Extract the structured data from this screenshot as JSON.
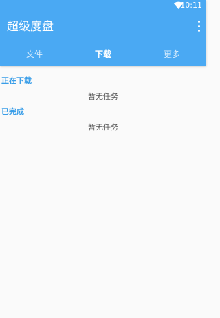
{
  "status_bar": {
    "time": "10:11"
  },
  "app_bar": {
    "title": "超级度盘"
  },
  "tabs": [
    {
      "label": "文件",
      "active": false
    },
    {
      "label": "下载",
      "active": true
    },
    {
      "label": "更多",
      "active": false
    }
  ],
  "sections": [
    {
      "title": "正在下载",
      "empty_text": "暂无任务"
    },
    {
      "title": "已完成",
      "empty_text": "暂无任务"
    }
  ],
  "colors": {
    "accent": "#4aa9f3",
    "section_header": "#3a9ee8",
    "background": "#fafafa"
  }
}
